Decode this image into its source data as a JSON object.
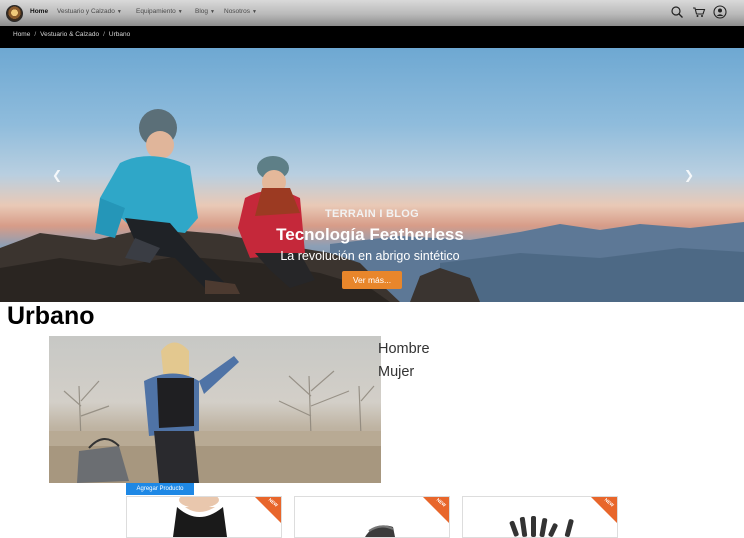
{
  "nav": {
    "logo_icon": "brand-logo-icon",
    "items": [
      {
        "label": "Home",
        "active": true,
        "has_dropdown": false
      },
      {
        "label": "Vestuario y Calzado",
        "active": false,
        "has_dropdown": true
      },
      {
        "label": "Equipamiento",
        "active": false,
        "has_dropdown": true
      },
      {
        "label": "Blog",
        "active": false,
        "has_dropdown": true
      },
      {
        "label": "Nosotros",
        "active": false,
        "has_dropdown": true
      }
    ],
    "icons": [
      "search-icon",
      "cart-icon",
      "user-account-icon"
    ]
  },
  "breadcrumb": [
    "Home",
    "Vestuario & Calzado",
    "Urbano"
  ],
  "hero": {
    "kicker": "TERRAIN I BLOG",
    "title": "Tecnología Featherless",
    "subtitle": "La revolución en abrigo sintético",
    "button": "Ver más...",
    "prev_icon": "chevron-left-icon",
    "next_icon": "chevron-right-icon"
  },
  "category": {
    "title": "Urbano",
    "subcategories": [
      "Hombre",
      "Mujer"
    ]
  },
  "products": {
    "add_label": "Agregar Producto",
    "badge": "NEW",
    "cards": [
      {
        "image": "tank-top-product-image"
      },
      {
        "image": "headband-product-image"
      },
      {
        "image": "gloves-product-image"
      }
    ]
  },
  "colors": {
    "breadcrumb_bg": "#000000",
    "button_orange": "#e8862b",
    "add_button_blue": "#1e88e5",
    "ribbon_orange": "#e8662b"
  }
}
